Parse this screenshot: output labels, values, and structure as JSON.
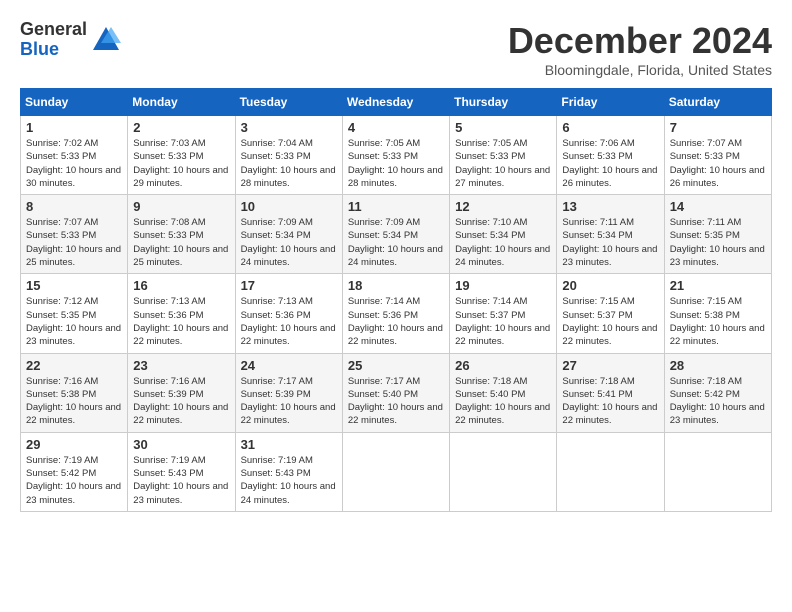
{
  "logo": {
    "general": "General",
    "blue": "Blue"
  },
  "header": {
    "month": "December 2024",
    "location": "Bloomingdale, Florida, United States"
  },
  "weekdays": [
    "Sunday",
    "Monday",
    "Tuesday",
    "Wednesday",
    "Thursday",
    "Friday",
    "Saturday"
  ],
  "weeks": [
    [
      {
        "day": "1",
        "sunrise": "7:02 AM",
        "sunset": "5:33 PM",
        "daylight": "10 hours and 30 minutes."
      },
      {
        "day": "2",
        "sunrise": "7:03 AM",
        "sunset": "5:33 PM",
        "daylight": "10 hours and 29 minutes."
      },
      {
        "day": "3",
        "sunrise": "7:04 AM",
        "sunset": "5:33 PM",
        "daylight": "10 hours and 28 minutes."
      },
      {
        "day": "4",
        "sunrise": "7:05 AM",
        "sunset": "5:33 PM",
        "daylight": "10 hours and 28 minutes."
      },
      {
        "day": "5",
        "sunrise": "7:05 AM",
        "sunset": "5:33 PM",
        "daylight": "10 hours and 27 minutes."
      },
      {
        "day": "6",
        "sunrise": "7:06 AM",
        "sunset": "5:33 PM",
        "daylight": "10 hours and 26 minutes."
      },
      {
        "day": "7",
        "sunrise": "7:07 AM",
        "sunset": "5:33 PM",
        "daylight": "10 hours and 26 minutes."
      }
    ],
    [
      {
        "day": "8",
        "sunrise": "7:07 AM",
        "sunset": "5:33 PM",
        "daylight": "10 hours and 25 minutes."
      },
      {
        "day": "9",
        "sunrise": "7:08 AM",
        "sunset": "5:33 PM",
        "daylight": "10 hours and 25 minutes."
      },
      {
        "day": "10",
        "sunrise": "7:09 AM",
        "sunset": "5:34 PM",
        "daylight": "10 hours and 24 minutes."
      },
      {
        "day": "11",
        "sunrise": "7:09 AM",
        "sunset": "5:34 PM",
        "daylight": "10 hours and 24 minutes."
      },
      {
        "day": "12",
        "sunrise": "7:10 AM",
        "sunset": "5:34 PM",
        "daylight": "10 hours and 24 minutes."
      },
      {
        "day": "13",
        "sunrise": "7:11 AM",
        "sunset": "5:34 PM",
        "daylight": "10 hours and 23 minutes."
      },
      {
        "day": "14",
        "sunrise": "7:11 AM",
        "sunset": "5:35 PM",
        "daylight": "10 hours and 23 minutes."
      }
    ],
    [
      {
        "day": "15",
        "sunrise": "7:12 AM",
        "sunset": "5:35 PM",
        "daylight": "10 hours and 23 minutes."
      },
      {
        "day": "16",
        "sunrise": "7:13 AM",
        "sunset": "5:36 PM",
        "daylight": "10 hours and 22 minutes."
      },
      {
        "day": "17",
        "sunrise": "7:13 AM",
        "sunset": "5:36 PM",
        "daylight": "10 hours and 22 minutes."
      },
      {
        "day": "18",
        "sunrise": "7:14 AM",
        "sunset": "5:36 PM",
        "daylight": "10 hours and 22 minutes."
      },
      {
        "day": "19",
        "sunrise": "7:14 AM",
        "sunset": "5:37 PM",
        "daylight": "10 hours and 22 minutes."
      },
      {
        "day": "20",
        "sunrise": "7:15 AM",
        "sunset": "5:37 PM",
        "daylight": "10 hours and 22 minutes."
      },
      {
        "day": "21",
        "sunrise": "7:15 AM",
        "sunset": "5:38 PM",
        "daylight": "10 hours and 22 minutes."
      }
    ],
    [
      {
        "day": "22",
        "sunrise": "7:16 AM",
        "sunset": "5:38 PM",
        "daylight": "10 hours and 22 minutes."
      },
      {
        "day": "23",
        "sunrise": "7:16 AM",
        "sunset": "5:39 PM",
        "daylight": "10 hours and 22 minutes."
      },
      {
        "day": "24",
        "sunrise": "7:17 AM",
        "sunset": "5:39 PM",
        "daylight": "10 hours and 22 minutes."
      },
      {
        "day": "25",
        "sunrise": "7:17 AM",
        "sunset": "5:40 PM",
        "daylight": "10 hours and 22 minutes."
      },
      {
        "day": "26",
        "sunrise": "7:18 AM",
        "sunset": "5:40 PM",
        "daylight": "10 hours and 22 minutes."
      },
      {
        "day": "27",
        "sunrise": "7:18 AM",
        "sunset": "5:41 PM",
        "daylight": "10 hours and 22 minutes."
      },
      {
        "day": "28",
        "sunrise": "7:18 AM",
        "sunset": "5:42 PM",
        "daylight": "10 hours and 23 minutes."
      }
    ],
    [
      {
        "day": "29",
        "sunrise": "7:19 AM",
        "sunset": "5:42 PM",
        "daylight": "10 hours and 23 minutes."
      },
      {
        "day": "30",
        "sunrise": "7:19 AM",
        "sunset": "5:43 PM",
        "daylight": "10 hours and 23 minutes."
      },
      {
        "day": "31",
        "sunrise": "7:19 AM",
        "sunset": "5:43 PM",
        "daylight": "10 hours and 24 minutes."
      },
      null,
      null,
      null,
      null
    ]
  ]
}
